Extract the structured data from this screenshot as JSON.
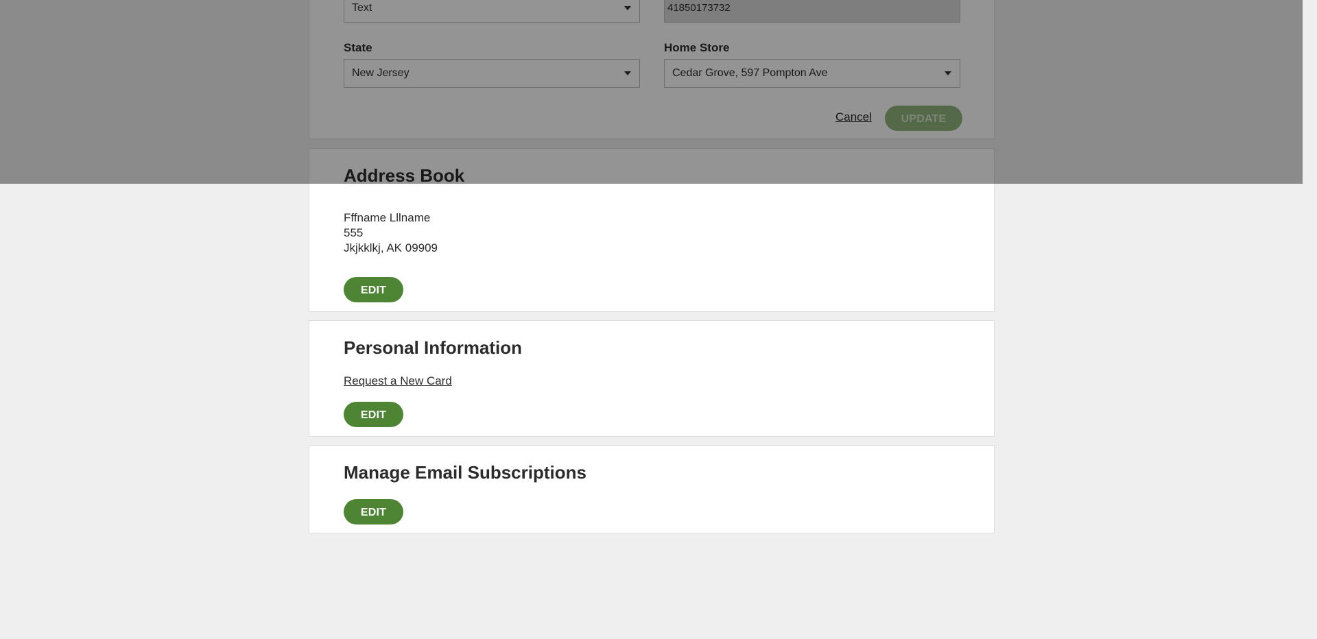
{
  "preferences_form": {
    "contact_method_value": "Text",
    "card_number_value": "41850173732",
    "state_label": "State",
    "state_value": "New Jersey",
    "home_store_label": "Home Store",
    "home_store_value": "Cedar Grove, 597 Pompton Ave",
    "cancel_label": "Cancel",
    "update_label": "UPDATE"
  },
  "address_book": {
    "title": "Address Book",
    "name": "Fffname Lllname",
    "street": "555",
    "city_state_zip": "Jkjkklkj, AK 09909",
    "edit_label": "EDIT"
  },
  "personal_information": {
    "title": "Personal Information",
    "request_card_label": "Request a New Card",
    "edit_label": "EDIT"
  },
  "email_subscriptions": {
    "title": "Manage Email Subscriptions",
    "edit_label": "EDIT"
  },
  "colors": {
    "accent_green": "#4e8535",
    "disabled_green": "#8fb57d",
    "page_background": "#efefef"
  }
}
